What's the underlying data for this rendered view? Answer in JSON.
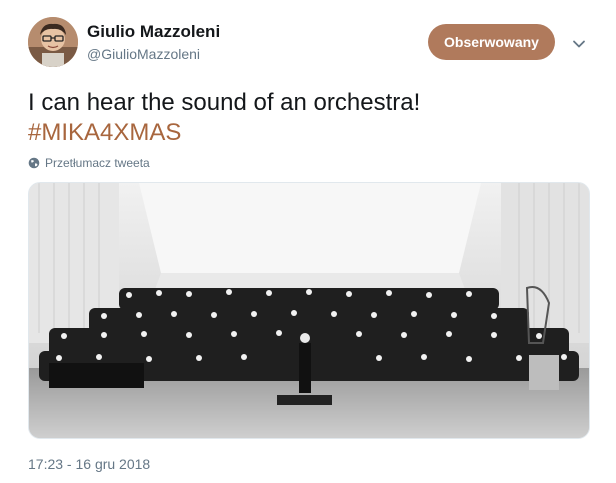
{
  "user": {
    "name": "Giulio Mazzoleni",
    "handle": "@GiulioMazzoleni"
  },
  "follow_button": {
    "label": "Obserwowany"
  },
  "tweet": {
    "text": "I can hear the sound of an orchestra!",
    "hashtag": "#MIKA4XMAS"
  },
  "translate": {
    "label": "Przetłumacz tweeta"
  },
  "timestamp": "17:23 - 16 gru 2018",
  "colors": {
    "accent": "#b07a5c",
    "hashtag": "#a8663e",
    "secondary_text": "#657786"
  },
  "icons": [
    "avatar",
    "chevron-down-icon",
    "globe-icon",
    "orchestra-photo"
  ]
}
